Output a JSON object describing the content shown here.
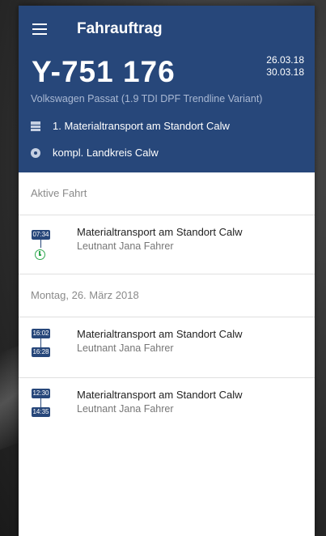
{
  "app": {
    "title": "Fahrauftrag"
  },
  "vehicle": {
    "plate": "Y-751 176",
    "date_start": "26.03.18",
    "date_end": "30.03.18",
    "model": "Volkswagen Passat (1.9 TDI DPF Trendline Variant)",
    "order": "1. Materialtransport am Standort Calw",
    "location": "kompl. Landkreis Calw"
  },
  "active": {
    "label": "Aktive Fahrt",
    "trip": {
      "time_start": "07:34",
      "title": "Materialtransport am Standort Calw",
      "driver": "Leutnant Jana Fahrer"
    }
  },
  "day": {
    "label": "Montag, 26. März 2018",
    "trips": [
      {
        "time_start": "16:02",
        "time_end": "16:28",
        "title": "Materialtransport am Standort Calw",
        "driver": "Leutnant Jana Fahrer"
      },
      {
        "time_start": "12:30",
        "time_end": "14:35",
        "title": "Materialtransport am Standort Calw",
        "driver": "Leutnant Jana Fahrer"
      }
    ]
  },
  "icons": {
    "menu": "menu-icon",
    "order": "list-icon",
    "location": "location-pin-icon",
    "active": "clock-icon"
  },
  "colors": {
    "header": "#27477a",
    "active_clock": "#2fa84f"
  }
}
